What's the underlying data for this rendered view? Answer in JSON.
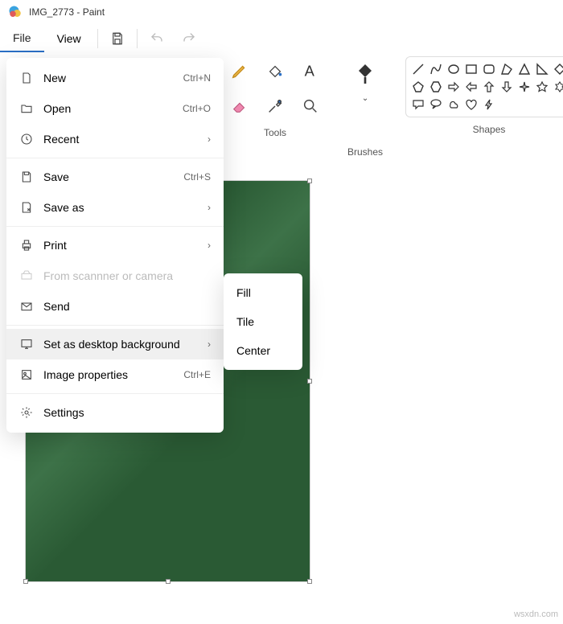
{
  "titlebar": {
    "title": "IMG_2773 - Paint"
  },
  "menubar": {
    "file": "File",
    "view": "View"
  },
  "ribbon": {
    "tools_label": "Tools",
    "brushes_label": "Brushes",
    "shapes_label": "Shapes"
  },
  "file_menu": {
    "new": {
      "label": "New",
      "shortcut": "Ctrl+N"
    },
    "open": {
      "label": "Open",
      "shortcut": "Ctrl+O"
    },
    "recent": {
      "label": "Recent"
    },
    "save": {
      "label": "Save",
      "shortcut": "Ctrl+S"
    },
    "save_as": {
      "label": "Save as"
    },
    "print": {
      "label": "Print"
    },
    "scanner": {
      "label": "From scannner or camera"
    },
    "send": {
      "label": "Send"
    },
    "desktop": {
      "label": "Set as desktop background"
    },
    "props": {
      "label": "Image properties",
      "shortcut": "Ctrl+E"
    },
    "settings": {
      "label": "Settings"
    }
  },
  "desktop_submenu": {
    "fill": "Fill",
    "tile": "Tile",
    "center": "Center"
  },
  "watermark": "wsxdn.com"
}
